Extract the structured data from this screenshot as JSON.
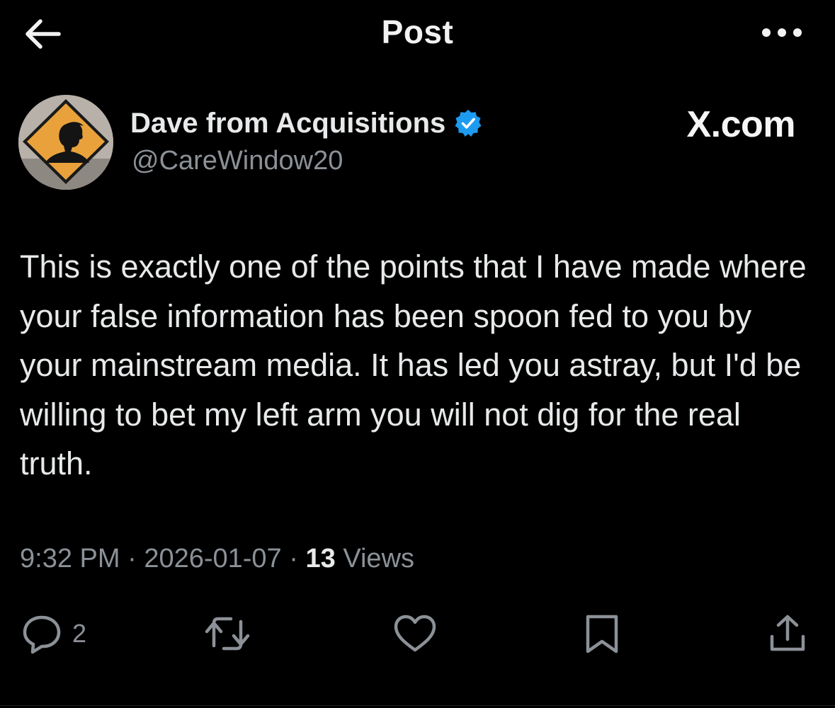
{
  "header": {
    "title": "Post",
    "back_icon": "arrow-left-icon",
    "more_icon": "more-horizontal-icon"
  },
  "author": {
    "display_name": "Dave from Acquisitions",
    "handle": "@CareWindow20",
    "verified": true,
    "verified_color": "#1d9bf0",
    "avatar_icon": "caution-sign-silhouette-avatar"
  },
  "brand": {
    "label": "X.com"
  },
  "tweet": {
    "text": "This is exactly one of the points that I have made where your false information has been spoon fed to you by your mainstream media. It has led you astray, but I'd be willing to bet my left arm you will not dig for the real truth."
  },
  "meta": {
    "time": "9:32 PM",
    "separator": "·",
    "date": "2026-01-07",
    "views_count": "13",
    "views_label": "Views"
  },
  "actions": {
    "reply_icon": "reply-bubble-icon",
    "reply_count": "2",
    "retweet_icon": "retweet-icon",
    "like_icon": "heart-icon",
    "bookmark_icon": "bookmark-icon",
    "share_icon": "share-icon"
  },
  "colors": {
    "background": "#000000",
    "text_primary": "#e7e9ea",
    "text_secondary": "#8b9197",
    "verified_blue": "#1d9bf0",
    "avatar_sign": "#e9a23b"
  }
}
